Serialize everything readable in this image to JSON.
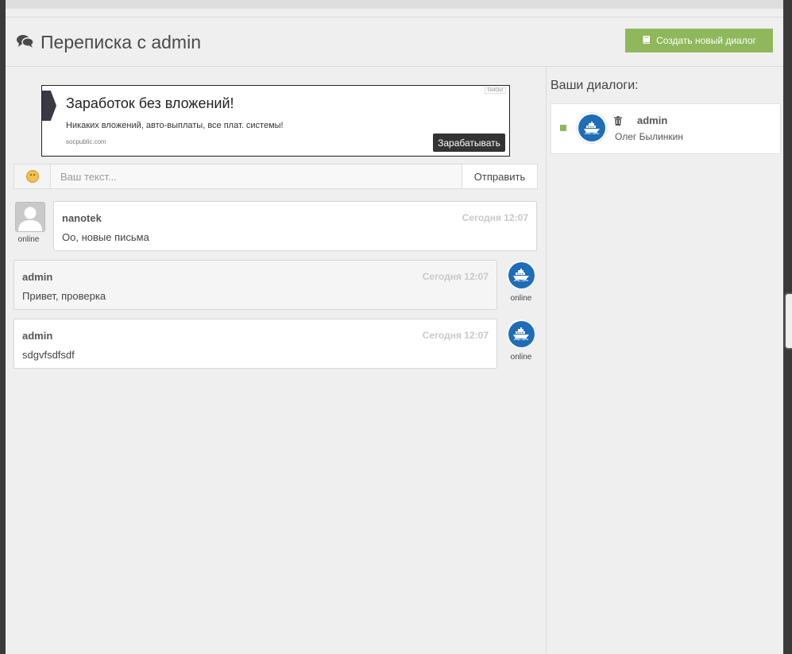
{
  "header": {
    "title": "Переписка с admin",
    "create_button": "Создать новый диалог"
  },
  "ad": {
    "title": "Заработок без вложений!",
    "text": "Никаких вложений, авто-выплаты, все плат. системы!",
    "domain": "socpublic.com",
    "button": "Зарабатывать",
    "badge": "GetOut"
  },
  "composer": {
    "placeholder": "Ваш текст...",
    "send_label": "Отправить"
  },
  "messages": [
    {
      "author": "nanotek",
      "time": "Сегодня 12:07",
      "text": "Оо, новые письма",
      "status": "online",
      "side": "left",
      "avatar": "default-user-icon"
    },
    {
      "author": "admin",
      "time": "Сегодня 12:07",
      "text": "Привет, проверка",
      "status": "online",
      "side": "right",
      "avatar": "ship-icon"
    },
    {
      "author": "admin",
      "time": "Сегодня 12:07",
      "text": "sdgvfsdfsdf",
      "status": "online",
      "side": "right",
      "avatar": "ship-icon"
    }
  ],
  "sidebar": {
    "title": "Ваши диалоги:",
    "dialogs": [
      {
        "name": "admin",
        "full_name": "Олег Былинкин",
        "avatar": "ship-icon",
        "status_color": "#8eb85b"
      }
    ]
  },
  "colors": {
    "accent_green": "#8eb85b",
    "avatar_blue": "#1e6db6"
  }
}
